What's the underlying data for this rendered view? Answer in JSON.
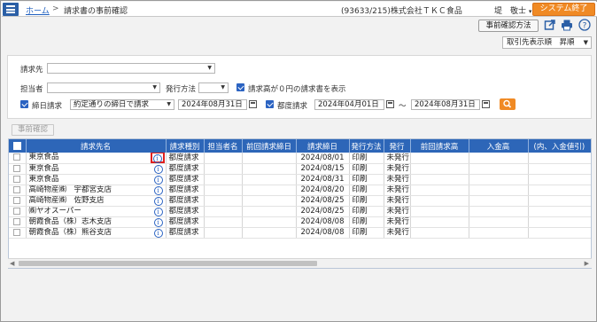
{
  "header": {
    "home_link": "ホーム",
    "separator": ">",
    "current_page": "請求書の事前確認",
    "company_info": "(93633/215)株式会社ＴＫＣ食品",
    "user_name": "堤　敬士",
    "logout_label": "システム終了"
  },
  "toolbar": {
    "method_button": "事前確認方法"
  },
  "sort": {
    "selected": "取引先表示順　昇順"
  },
  "filters": {
    "billing_to_label": "請求先",
    "billing_to_value": "",
    "person_label": "担当者",
    "person_value": "",
    "issue_method_label": "発行方法",
    "issue_method_value": "",
    "zero_amount_label": "請求高が０円の請求書を表示",
    "closing_label": "締日請求",
    "closing_select": "約定通りの締日で請求",
    "closing_date": "2024年08月31日",
    "each_label": "都度請求",
    "each_date_from": "2024年04月01日",
    "tilde": "～",
    "each_date_to": "2024年08月31日"
  },
  "actions": {
    "precheck_button": "事前確認"
  },
  "table": {
    "columns": [
      "請求先名",
      "請求種別",
      "担当者名",
      "前回請求締日",
      "請求締日",
      "発行方法",
      "発行",
      "前回請求高",
      "入金高",
      "(内、入金値引)"
    ],
    "rows": [
      {
        "name": "東京食品",
        "type": "都度請求",
        "person": "",
        "prev_close": "",
        "close": "2024/08/01",
        "method": "印刷",
        "issued": "未発行",
        "prev_amount": "",
        "payment": "",
        "discount": ""
      },
      {
        "name": "東京食品",
        "type": "都度請求",
        "person": "",
        "prev_close": "",
        "close": "2024/08/15",
        "method": "印刷",
        "issued": "未発行",
        "prev_amount": "",
        "payment": "",
        "discount": ""
      },
      {
        "name": "東京食品",
        "type": "都度請求",
        "person": "",
        "prev_close": "",
        "close": "2024/08/31",
        "method": "印刷",
        "issued": "未発行",
        "prev_amount": "",
        "payment": "",
        "discount": ""
      },
      {
        "name": "高崎物産㈱　宇都宮支店",
        "type": "都度請求",
        "person": "",
        "prev_close": "",
        "close": "2024/08/20",
        "method": "印刷",
        "issued": "未発行",
        "prev_amount": "",
        "payment": "",
        "discount": ""
      },
      {
        "name": "高崎物産㈱　佐野支店",
        "type": "都度請求",
        "person": "",
        "prev_close": "",
        "close": "2024/08/25",
        "method": "印刷",
        "issued": "未発行",
        "prev_amount": "",
        "payment": "",
        "discount": ""
      },
      {
        "name": "㈱ヤオスーパー",
        "type": "都度請求",
        "person": "",
        "prev_close": "",
        "close": "2024/08/25",
        "method": "印刷",
        "issued": "未発行",
        "prev_amount": "",
        "payment": "",
        "discount": ""
      },
      {
        "name": "朝霞食品（株）志木支店",
        "type": "都度請求",
        "person": "",
        "prev_close": "",
        "close": "2024/08/08",
        "method": "印刷",
        "issued": "未発行",
        "prev_amount": "",
        "payment": "",
        "discount": ""
      },
      {
        "name": "朝霞食品（株）熊谷支店",
        "type": "都度請求",
        "person": "",
        "prev_close": "",
        "close": "2024/08/08",
        "method": "印刷",
        "issued": "未発行",
        "prev_amount": "",
        "payment": "",
        "discount": ""
      }
    ]
  },
  "colors": {
    "accent": "#2d66b8",
    "orange": "#f08a24",
    "highlight": "#e0201e"
  }
}
